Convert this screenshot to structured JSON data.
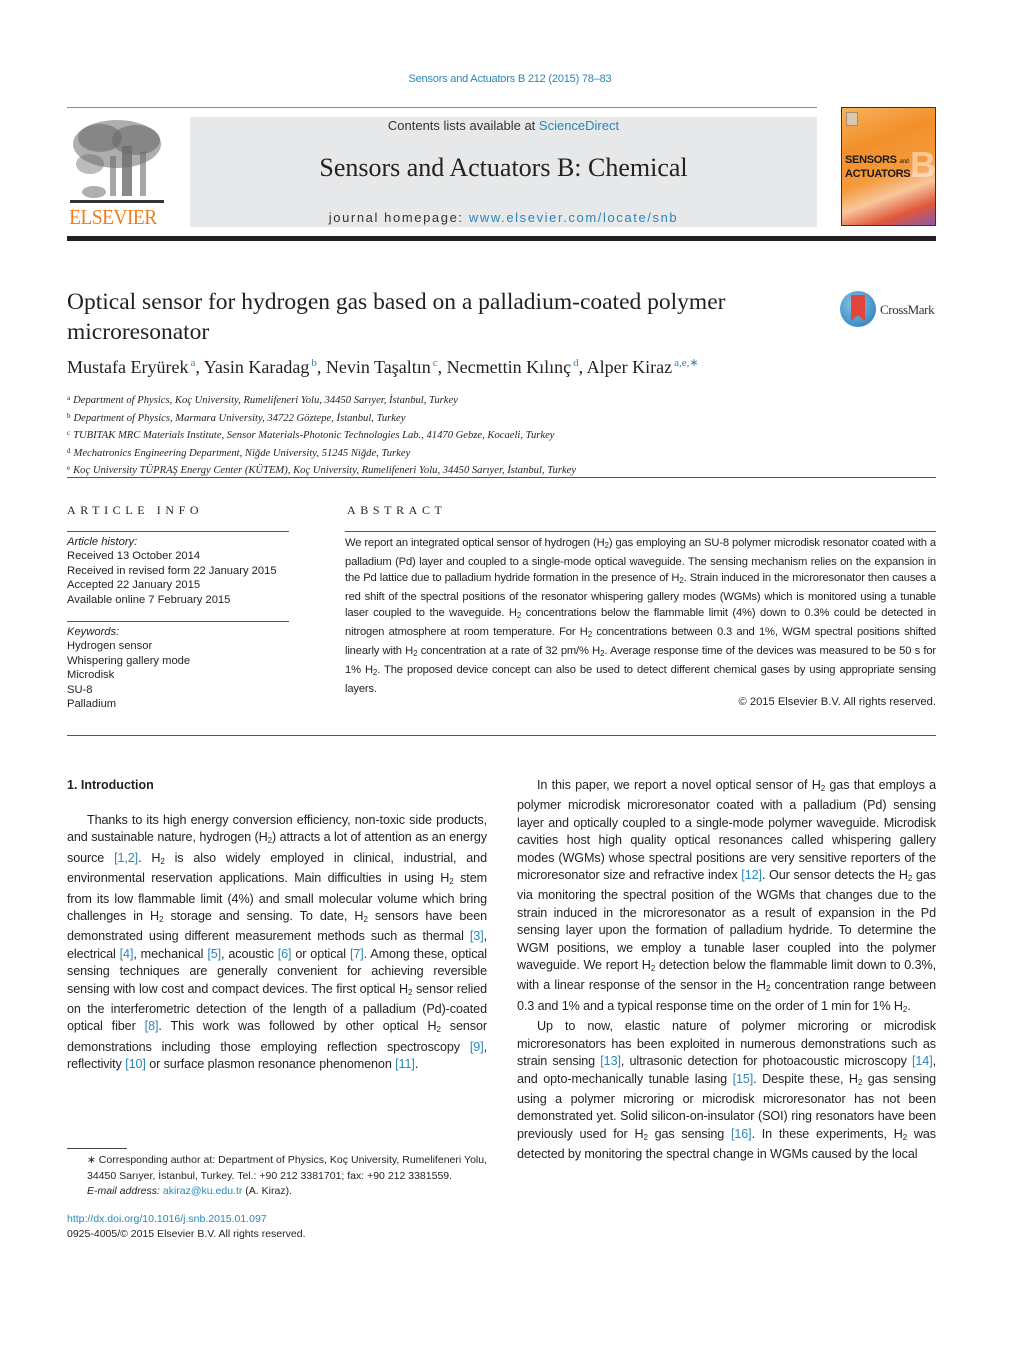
{
  "header": {
    "citation": "Sensors and Actuators B 212 (2015) 78–83",
    "publisher_logo": "ELSEVIER",
    "contents_prefix": "Contents lists available at ",
    "contents_link": "ScienceDirect",
    "journal_name": "Sensors and Actuators B: Chemical",
    "homepage_prefix": "journal homepage: ",
    "homepage_link": "www.elsevier.com/locate/snb",
    "cover": {
      "line1": "SENSORS",
      "and": "and",
      "line2": "ACTUATORS",
      "letter": "B"
    },
    "colors": {
      "link": "#2a87b8",
      "elsevier_orange": "#f07c1b",
      "banner_bg": "#e7e8e9"
    }
  },
  "article": {
    "title": "Optical sensor for hydrogen gas based on a palladium-coated polymer microresonator",
    "crossmark_label": "CrossMark",
    "authors": [
      {
        "name": "Mustafa Eryürek",
        "aff": "a"
      },
      {
        "name": "Yasin Karadag",
        "aff": "b"
      },
      {
        "name": "Nevin Taşaltın",
        "aff": "c"
      },
      {
        "name": "Necmettin Kılınç",
        "aff": "d"
      },
      {
        "name": "Alper Kiraz",
        "aff": "a,e,∗"
      }
    ],
    "affiliations": [
      {
        "key": "a",
        "text": "Department of Physics, Koç University, Rumelifeneri Yolu, 34450 Sarıyer, İstanbul, Turkey"
      },
      {
        "key": "b",
        "text": "Department of Physics, Marmara University, 34722 Göztepe, İstanbul, Turkey"
      },
      {
        "key": "c",
        "text": "TUBITAK MRC Materials Institute, Sensor Materials-Photonic Technologies Lab., 41470 Gebze, Kocaeli, Turkey"
      },
      {
        "key": "d",
        "text": "Mechatronics Engineering Department, Niğde University, 51245 Niğde, Turkey"
      },
      {
        "key": "e",
        "text": "Koç University TÜPRAŞ Energy Center (KÜTEM), Koç University, Rumelifeneri Yolu, 34450 Sarıyer, İstanbul, Turkey"
      }
    ]
  },
  "article_info": {
    "heading": "ARTICLE INFO",
    "history_label": "Article history:",
    "history": [
      "Received 13 October 2014",
      "Received in revised form 22 January 2015",
      "Accepted 22 January 2015",
      "Available online 7 February 2015"
    ],
    "keywords_label": "Keywords:",
    "keywords": [
      "Hydrogen sensor",
      "Whispering gallery mode",
      "Microdisk",
      "SU-8",
      "Palladium"
    ]
  },
  "abstract": {
    "heading": "ABSTRACT",
    "text": "We report an integrated optical sensor of hydrogen (H₂) gas employing an SU-8 polymer microdisk resonator coated with a palladium (Pd) layer and coupled to a single-mode optical waveguide. The sensing mechanism relies on the expansion in the Pd lattice due to palladium hydride formation in the presence of H₂. Strain induced in the microresonator then causes a red shift of the spectral positions of the resonator whispering gallery modes (WGMs) which is monitored using a tunable laser coupled to the waveguide. H₂ concentrations below the flammable limit (4%) down to 0.3% could be detected in nitrogen atmosphere at room temperature. For H₂ concentrations between 0.3 and 1%, WGM spectral positions shifted linearly with H₂ concentration at a rate of 32 pm/% H₂. Average response time of the devices was measured to be 50 s for 1% H₂. The proposed device concept can also be used to detect different chemical gases by using appropriate sensing layers.",
    "copyright": "© 2015 Elsevier B.V. All rights reserved."
  },
  "body": {
    "section_heading": "1.  Introduction",
    "left_column": [
      [
        {
          "t": "Thanks to its high energy conversion efficiency, non-toxic side products, and sustainable nature, hydrogen (H₂) attracts a lot of attention as an energy source "
        },
        {
          "ref": "[1,2]"
        },
        {
          "t": ". H₂ is also widely employed in clinical, industrial, and environmental reservation applications. Main difficulties in using H₂ stem from its low flammable limit (4%) and small molecular volume which bring challenges in H₂ storage and sensing. To date, H₂ sensors have been demonstrated using different measurement methods such as thermal "
        },
        {
          "ref": "[3]"
        },
        {
          "t": ", electrical "
        },
        {
          "ref": "[4]"
        },
        {
          "t": ", mechanical "
        },
        {
          "ref": "[5]"
        },
        {
          "t": ", acoustic "
        },
        {
          "ref": "[6]"
        },
        {
          "t": " or optical "
        },
        {
          "ref": "[7]"
        },
        {
          "t": ". Among these, optical sensing techniques are generally convenient for achieving reversible sensing with low cost and compact devices. The first optical H₂ sensor relied on the interferometric detection of the length of a palladium (Pd)-coated optical fiber "
        },
        {
          "ref": "[8]"
        },
        {
          "t": ". This work was followed by other optical H₂ sensor demonstrations including those employing reflection spectroscopy "
        },
        {
          "ref": "[9]"
        },
        {
          "t": ", reflectivity "
        },
        {
          "ref": "[10]"
        },
        {
          "t": " or surface plasmon resonance phenomenon "
        },
        {
          "ref": "[11]"
        },
        {
          "t": "."
        }
      ]
    ],
    "right_column": [
      [
        {
          "t": "In this paper, we report a novel optical sensor of H₂ gas that employs a polymer microdisk microresonator coated with a palladium (Pd) sensing layer and optically coupled to a single-mode polymer waveguide. Microdisk cavities host high quality optical resonances called whispering gallery modes (WGMs) whose spectral positions are very sensitive reporters of the microresonator size and refractive index "
        },
        {
          "ref": "[12]"
        },
        {
          "t": ". Our sensor detects the H₂ gas via monitoring the spectral position of the WGMs that changes due to the strain induced in the microresonator as a result of expansion in the Pd sensing layer upon the formation of palladium hydride. To determine the WGM positions, we employ a tunable laser coupled into the polymer waveguide. We report H₂ detection below the flammable limit down to 0.3%, with a linear response of the sensor in the H₂ concentration range between 0.3 and 1% and a typical response time on the order of 1 min for 1% H₂."
        }
      ],
      [
        {
          "t": "Up to now, elastic nature of polymer microring or microdisk microresonators has been exploited in numerous demonstrations such as strain sensing "
        },
        {
          "ref": "[13]"
        },
        {
          "t": ", ultrasonic detection for photoacoustic microscopy "
        },
        {
          "ref": "[14]"
        },
        {
          "t": ", and opto-mechanically tunable lasing "
        },
        {
          "ref": "[15]"
        },
        {
          "t": ". Despite these, H₂ gas sensing using a polymer microring or microdisk microresonator has not been demonstrated yet. Solid silicon-on-insulator (SOI) ring resonators have been previously used for H₂ gas sensing "
        },
        {
          "ref": "[16]"
        },
        {
          "t": ". In these experiments, H₂ was detected by monitoring the spectral change in WGMs caused by the local"
        }
      ]
    ]
  },
  "footnote": {
    "corresponding": "∗  Corresponding author at: Department of Physics, Koç University, Rumelifeneri Yolu, 34450 Sarıyer, İstanbul, Turkey. Tel.: +90 212 3381701; fax: +90 212 3381559.",
    "email_label": "E-mail address: ",
    "email": "akiraz@ku.edu.tr",
    "email_suffix": " (A. Kiraz).",
    "doi": "http://dx.doi.org/10.1016/j.snb.2015.01.097",
    "issn": "0925-4005/© 2015 Elsevier B.V. All rights reserved."
  }
}
